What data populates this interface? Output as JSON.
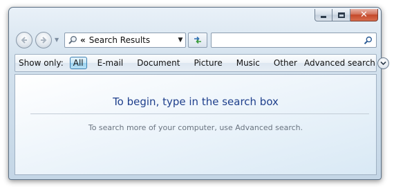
{
  "window": {
    "controls": {
      "minimize_icon": "minimize-icon",
      "maximize_icon": "maximize-icon",
      "close_icon": "close-icon",
      "close_glyph": "✕"
    }
  },
  "nav": {
    "back_icon": "back-arrow-icon",
    "forward_icon": "forward-arrow-icon",
    "history_icon": "chevron-down-icon",
    "address": {
      "separator": "«",
      "text": "Search Results"
    },
    "refresh_icon": "refresh-icon"
  },
  "search": {
    "value": "",
    "placeholder": ""
  },
  "filter": {
    "label": "Show only:",
    "items": [
      {
        "label": "All",
        "active": true
      },
      {
        "label": "E-mail",
        "active": false
      },
      {
        "label": "Document",
        "active": false
      },
      {
        "label": "Picture",
        "active": false
      },
      {
        "label": "Music",
        "active": false
      },
      {
        "label": "Other",
        "active": false
      }
    ],
    "advanced_label": "Advanced search"
  },
  "content": {
    "headline": "To begin, type in the search box",
    "subtext": "To search more of your computer, use Advanced search."
  },
  "colors": {
    "headline": "#1e3f8c",
    "active_filter_border": "#3c7fb1",
    "close_button": "#c4482a"
  }
}
